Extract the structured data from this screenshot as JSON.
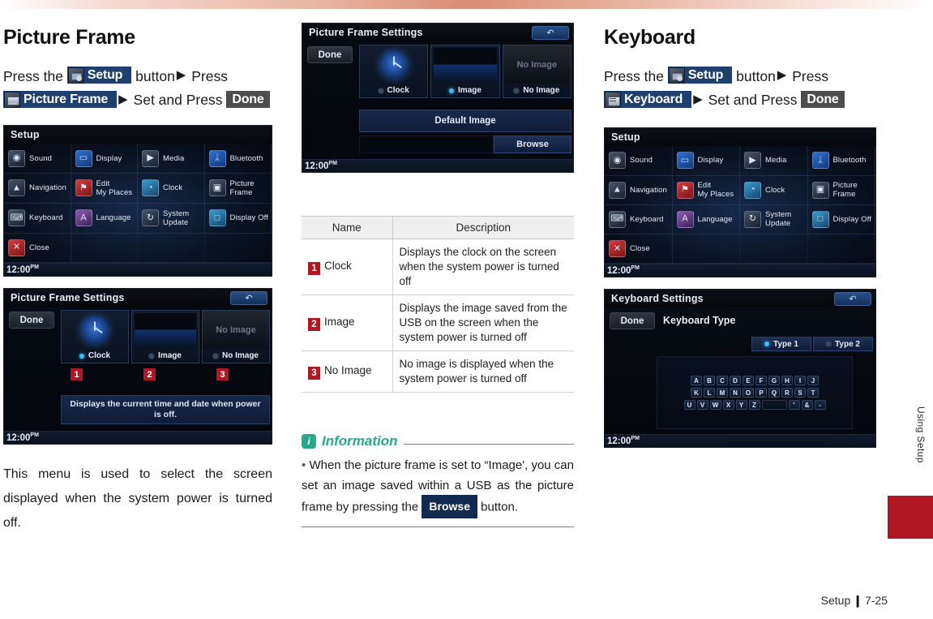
{
  "colors": {
    "accent_red": "#b01722",
    "badge_navy": "#1f3f6e",
    "badge_gray": "#4d4d4d",
    "info_teal": "#2aa98a"
  },
  "left": {
    "title": "Picture Frame",
    "instruction": {
      "part1": "Press the",
      "badge_setup": "Setup",
      "part2": "button",
      "arrow": "▶",
      "part3": "Press",
      "badge_picture_frame": "Picture Frame",
      "arrow2": "▶",
      "part4": "Set and Press",
      "badge_done": "Done"
    },
    "body_text": "This menu is used to select the screen displayed when the system power is turned off.",
    "screenshot_setup": {
      "title": "Setup",
      "clock": "12:00",
      "clock_suffix": "PM",
      "items": [
        {
          "label": "Sound",
          "icon": "speaker-icon",
          "tone": ""
        },
        {
          "label": "Display",
          "icon": "monitor-icon",
          "tone": "blue"
        },
        {
          "label": "Media",
          "icon": "media-icon",
          "tone": ""
        },
        {
          "label": "Bluetooth",
          "icon": "bluetooth-icon",
          "tone": "blue"
        },
        {
          "label": "Navigation",
          "icon": "navigation-icon",
          "tone": ""
        },
        {
          "label": "Edit\nMy Places",
          "icon": "map-pin-icon",
          "tone": "red"
        },
        {
          "label": "Clock",
          "icon": "clock-icon",
          "tone": "teal"
        },
        {
          "label": "Picture\nFrame",
          "icon": "picture-frame-icon",
          "tone": ""
        },
        {
          "label": "Keyboard",
          "icon": "keyboard-icon",
          "tone": ""
        },
        {
          "label": "Language",
          "icon": "language-icon",
          "tone": "green"
        },
        {
          "label": "System\nUpdate",
          "icon": "system-update-icon",
          "tone": ""
        },
        {
          "label": "Display Off",
          "icon": "display-off-icon",
          "tone": "teal"
        },
        {
          "label": "Close",
          "icon": "close-icon",
          "tone": "red"
        }
      ]
    },
    "screenshot_pf": {
      "title": "Picture Frame Settings",
      "back": "↶",
      "done": "Done",
      "options": [
        {
          "label": "Clock",
          "selected": true,
          "marker": "1"
        },
        {
          "label": "Image",
          "selected": false,
          "marker": "2"
        },
        {
          "label": "No Image",
          "selected": false,
          "marker": "3"
        }
      ],
      "no_image_text": "No Image",
      "description": "Displays the current time and date when power is off.",
      "clock": "12:00",
      "clock_suffix": "PM"
    }
  },
  "mid": {
    "screenshot_pf2": {
      "title": "Picture Frame Settings",
      "back": "↶",
      "done": "Done",
      "options": [
        {
          "label": "Clock",
          "selected": false
        },
        {
          "label": "Image",
          "selected": true
        },
        {
          "label": "No Image",
          "selected": false
        }
      ],
      "no_image_text": "No Image",
      "default_image": "Default Image",
      "browse": "Browse",
      "clock": "12:00",
      "clock_suffix": "PM"
    },
    "table": {
      "headers": [
        "Name",
        "Description"
      ],
      "rows": [
        {
          "num": "1",
          "name": "Clock",
          "description": "Displays the clock on the screen when the system power is turned off"
        },
        {
          "num": "2",
          "name": "Image",
          "description": "Displays the image saved from the USB on the screen when the system power is turned off"
        },
        {
          "num": "3",
          "name": "No Image",
          "description": "No image is displayed when the system power is turned off"
        }
      ]
    },
    "information": {
      "icon_letter": "i",
      "title": "Information",
      "bullet": "•",
      "text_before": "When the picture frame is set to “Image', you can set an image saved within a USB as the picture frame by pressing the",
      "browse_badge": "Browse",
      "text_after": "button."
    }
  },
  "right": {
    "title": "Keyboard",
    "instruction": {
      "part1": "Press the",
      "badge_setup": "Setup",
      "part2": "button",
      "arrow": "▶",
      "part3": "Press",
      "badge_keyboard": "Keyboard",
      "arrow2": "▶",
      "part4": "Set and Press",
      "badge_done": "Done"
    },
    "screenshot_setup": {
      "title": "Setup",
      "clock": "12:00",
      "clock_suffix": "PM",
      "items": [
        {
          "label": "Sound",
          "icon": "speaker-icon",
          "tone": ""
        },
        {
          "label": "Display",
          "icon": "monitor-icon",
          "tone": "blue"
        },
        {
          "label": "Media",
          "icon": "media-icon",
          "tone": ""
        },
        {
          "label": "Bluetooth",
          "icon": "bluetooth-icon",
          "tone": "blue"
        },
        {
          "label": "Navigation",
          "icon": "navigation-icon",
          "tone": ""
        },
        {
          "label": "Edit\nMy Places",
          "icon": "map-pin-icon",
          "tone": "red"
        },
        {
          "label": "Clock",
          "icon": "clock-icon",
          "tone": "teal"
        },
        {
          "label": "Picture\nFrame",
          "icon": "picture-frame-icon",
          "tone": ""
        },
        {
          "label": "Keyboard",
          "icon": "keyboard-icon",
          "tone": ""
        },
        {
          "label": "Language",
          "icon": "language-icon",
          "tone": "green"
        },
        {
          "label": "System\nUpdate",
          "icon": "system-update-icon",
          "tone": ""
        },
        {
          "label": "Display Off",
          "icon": "display-off-icon",
          "tone": "teal"
        },
        {
          "label": "Close",
          "icon": "close-icon",
          "tone": "red"
        }
      ]
    },
    "screenshot_kb": {
      "title": "Keyboard Settings",
      "back": "↶",
      "done": "Done",
      "subtitle": "Keyboard Type",
      "types": [
        {
          "label": "Type 1",
          "selected": true
        },
        {
          "label": "Type 2",
          "selected": false
        }
      ],
      "keys": [
        [
          "A",
          "B",
          "C",
          "D",
          "E",
          "F",
          "G",
          "H",
          "I",
          "J"
        ],
        [
          "K",
          "L",
          "M",
          "N",
          "O",
          "P",
          "Q",
          "R",
          "S",
          "T"
        ],
        [
          "U",
          "V",
          "W",
          "X",
          "Y",
          "Z",
          "_SPACE_",
          "'",
          "&",
          "-"
        ]
      ],
      "clock": "12:00",
      "clock_suffix": "PM"
    }
  },
  "side_tab": {
    "label": "Using Setup"
  },
  "footer": {
    "section": "Setup",
    "separator": "❙",
    "page": "7-25"
  }
}
